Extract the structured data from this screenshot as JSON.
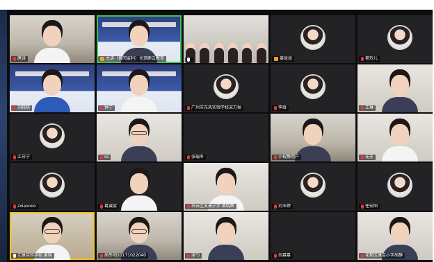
{
  "participants": [
    {
      "name": "唐诗"
    },
    {
      "name": "主讲（黄冈监利）长颈鹿云教育"
    },
    {
      "name": ""
    },
    {
      "name": "姜慧慧"
    },
    {
      "name": "艳玲儿"
    },
    {
      "name": "刘晓晓"
    },
    {
      "name": "钟宁"
    },
    {
      "name": "广州市东风实验学校宋万秋"
    },
    {
      "name": "李霞"
    },
    {
      "name": "王琳"
    },
    {
      "name": "江芬宁"
    },
    {
      "name": "ss"
    },
    {
      "name": "张瑞冬"
    },
    {
      "name": "小祝豫用户"
    },
    {
      "name": "无无"
    },
    {
      "name": "zxiaoooo"
    },
    {
      "name": "葛诚雯"
    },
    {
      "name": "白云区夏景小学 黄晓辉"
    },
    {
      "name": "刘玉婷"
    },
    {
      "name": "任宏阳"
    },
    {
      "name": "汇景实验学校 黄晓"
    },
    {
      "name": "胡冬阳20171022040"
    },
    {
      "name": "凌勺"
    },
    {
      "name": "尚慕慕"
    },
    {
      "name": "花都区雅宝小学胡静"
    }
  ]
}
